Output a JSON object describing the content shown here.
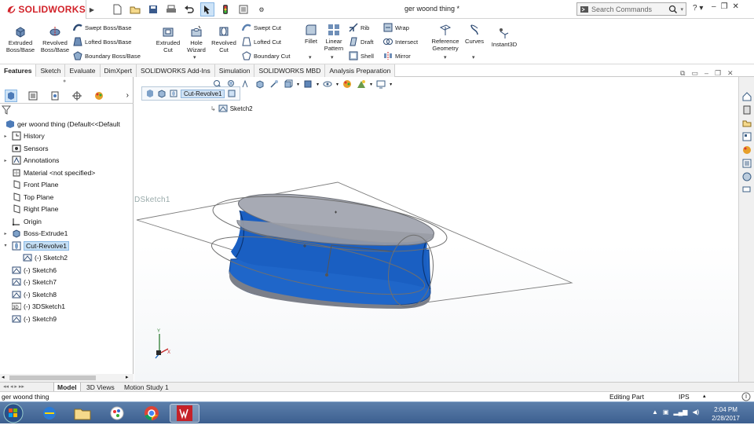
{
  "app": {
    "brand": "SOLIDWORKS",
    "title": "ger woond thing *"
  },
  "search": {
    "placeholder": "Search Commands"
  },
  "help_label": "?",
  "ribbon": {
    "extruded_boss": "Extruded Boss/Base",
    "revolved_boss": "Revolved Boss/Base",
    "swept_boss": "Swept Boss/Base",
    "lofted_boss": "Lofted Boss/Base",
    "boundary_boss": "Boundary Boss/Base",
    "extruded_cut": "Extruded Cut",
    "hole_wizard": "Hole Wizard",
    "revolved_cut": "Revolved Cut",
    "swept_cut": "Swept Cut",
    "lofted_cut": "Lofted Cut",
    "boundary_cut": "Boundary Cut",
    "fillet": "Fillet",
    "linear_pattern": "Linear Pattern",
    "rib": "Rib",
    "draft": "Draft",
    "shell": "Shell",
    "wrap": "Wrap",
    "intersect": "Intersect",
    "mirror": "Mirror",
    "reference_geometry": "Reference Geometry",
    "curves": "Curves",
    "instant3d": "Instant3D"
  },
  "tabs": [
    "Features",
    "Sketch",
    "Evaluate",
    "DimXpert",
    "SOLIDWORKS Add-Ins",
    "Simulation",
    "SOLIDWORKS MBD",
    "Analysis Preparation"
  ],
  "tree": {
    "root": "ger woond thing  (Default<<Default",
    "items": [
      {
        "label": "History",
        "icon": "history-icon",
        "expand": "▸",
        "indent": 0
      },
      {
        "label": "Sensors",
        "icon": "sensor-icon",
        "expand": "",
        "indent": 0
      },
      {
        "label": "Annotations",
        "icon": "annotation-icon",
        "expand": "▸",
        "indent": 0
      },
      {
        "label": "Material <not specified>",
        "icon": "material-icon",
        "expand": "",
        "indent": 0
      },
      {
        "label": "Front Plane",
        "icon": "plane-icon",
        "expand": "",
        "indent": 0
      },
      {
        "label": "Top Plane",
        "icon": "plane-icon",
        "expand": "",
        "indent": 0
      },
      {
        "label": "Right Plane",
        "icon": "plane-icon",
        "expand": "",
        "indent": 0
      },
      {
        "label": "Origin",
        "icon": "origin-icon",
        "expand": "",
        "indent": 0
      },
      {
        "label": "Boss-Extrude1",
        "icon": "extrude-icon",
        "expand": "▸",
        "indent": 0
      },
      {
        "label": "Cut-Revolve1",
        "icon": "revolve-icon",
        "expand": "▾",
        "indent": 0
      },
      {
        "label": "(-) Sketch2",
        "icon": "sketch-icon",
        "expand": "",
        "indent": 1
      },
      {
        "label": "(-) Sketch6",
        "icon": "sketch-icon",
        "expand": "",
        "indent": 0
      },
      {
        "label": "(-) Sketch7",
        "icon": "sketch-icon",
        "expand": "",
        "indent": 0
      },
      {
        "label": "(-) Sketch8",
        "icon": "sketch-icon",
        "expand": "",
        "indent": 0
      },
      {
        "label": "(-) 3DSketch1",
        "icon": "3dsketch-icon",
        "expand": "",
        "indent": 0
      },
      {
        "label": "(-) Sketch9",
        "icon": "sketch-icon",
        "expand": "",
        "indent": 0
      }
    ]
  },
  "breadcrumb": {
    "feature": "Cut-Revolve1",
    "child": "Sketch2"
  },
  "viewport": {
    "sketch_label": "DSketch1"
  },
  "bottom_tabs": [
    "Model",
    "3D Views",
    "Motion Study 1"
  ],
  "status": {
    "doc": "ger woond thing",
    "mode": "Editing Part",
    "units": "IPS"
  },
  "clock": {
    "time": "2:04 PM",
    "date": "2/28/2017"
  },
  "colors": {
    "model_blue": "#1f66c9",
    "model_top": "#a7aab4",
    "selection": "#c5dff5",
    "brand_red": "#d2232a"
  }
}
